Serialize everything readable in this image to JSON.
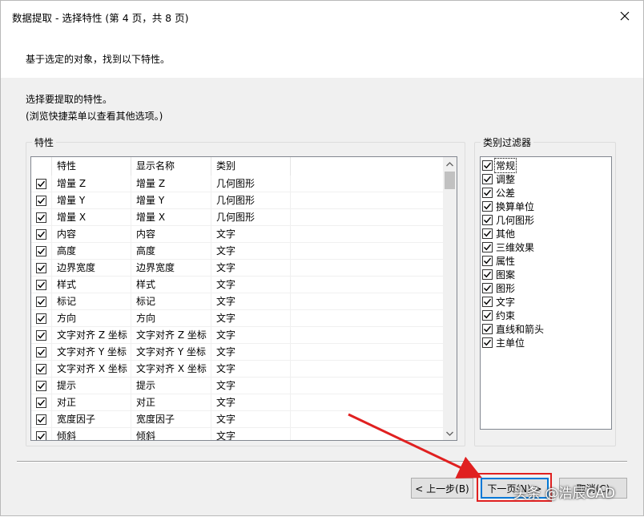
{
  "window": {
    "title": "数据提取 - 选择特性 (第 4 页，共 8 页)",
    "close_icon": "close-icon"
  },
  "header": {
    "text": "基于选定的对象，找到以下特性。"
  },
  "instructions": {
    "line1": "选择要提取的特性。",
    "line2": "(浏览快捷菜单以查看其他选项。)"
  },
  "properties": {
    "group_label": "特性",
    "columns": [
      "特性",
      "显示名称",
      "类别"
    ],
    "rows": [
      {
        "property": "增量 Z",
        "display": "增量 Z",
        "category": "几何图形"
      },
      {
        "property": "增量 Y",
        "display": "增量 Y",
        "category": "几何图形"
      },
      {
        "property": "增量 X",
        "display": "增量 X",
        "category": "几何图形"
      },
      {
        "property": "内容",
        "display": "内容",
        "category": "文字"
      },
      {
        "property": "高度",
        "display": "高度",
        "category": "文字"
      },
      {
        "property": "边界宽度",
        "display": "边界宽度",
        "category": "文字"
      },
      {
        "property": "样式",
        "display": "样式",
        "category": "文字"
      },
      {
        "property": "标记",
        "display": "标记",
        "category": "文字"
      },
      {
        "property": "方向",
        "display": "方向",
        "category": "文字"
      },
      {
        "property": "文字对齐 Z 坐标",
        "display": "文字对齐 Z 坐标",
        "category": "文字"
      },
      {
        "property": "文字对齐 Y 坐标",
        "display": "文字对齐 Y 坐标",
        "category": "文字"
      },
      {
        "property": "文字对齐 X 坐标",
        "display": "文字对齐 X 坐标",
        "category": "文字"
      },
      {
        "property": "提示",
        "display": "提示",
        "category": "文字"
      },
      {
        "property": "对正",
        "display": "对正",
        "category": "文字"
      },
      {
        "property": "宽度因子",
        "display": "宽度因子",
        "category": "文字"
      },
      {
        "property": "倾斜",
        "display": "倾斜",
        "category": "文字"
      }
    ]
  },
  "filter": {
    "group_label": "类别过滤器",
    "items": [
      "常规",
      "调整",
      "公差",
      "换算单位",
      "几何图形",
      "其他",
      "三维效果",
      "属性",
      "图案",
      "图形",
      "文字",
      "约束",
      "直线和箭头",
      "主单位"
    ]
  },
  "buttons": {
    "back": "< 上一步(B)",
    "next": "下一页(N) >",
    "cancel": "取消(C)"
  },
  "watermark": "头条 @浩辰CAD",
  "colors": {
    "highlight": "#e02020",
    "focus_border": "#0078d7"
  }
}
